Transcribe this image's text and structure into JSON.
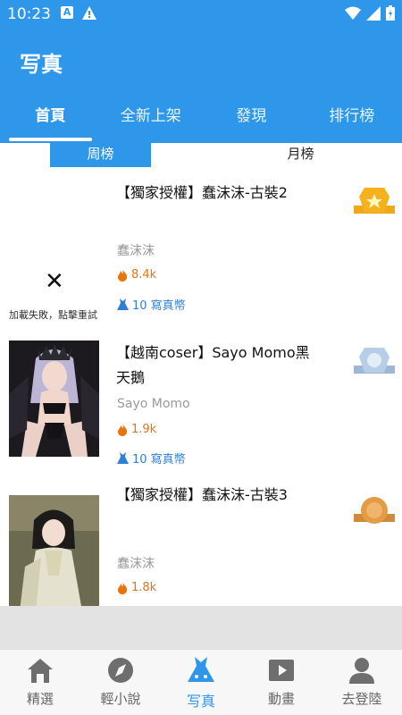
{
  "status": {
    "time": "10:23"
  },
  "appbar": {
    "title": "写真"
  },
  "tabs": [
    {
      "label": "首頁",
      "active": true
    },
    {
      "label": "全新上架",
      "active": false
    },
    {
      "label": "發現",
      "active": false
    },
    {
      "label": "排行榜",
      "active": false
    }
  ],
  "subtabs": [
    {
      "label": "周榜",
      "active": true
    },
    {
      "label": "月榜",
      "active": false
    }
  ],
  "items": [
    {
      "title": "【獨家授權】蠢沫沫-古裝2",
      "author": "蠢沫沫",
      "hot": "8.4k",
      "coins": "10 寫真幣",
      "thumb_error": "加載失敗，點擊重試",
      "rank": 1
    },
    {
      "title": "【越南coser】Sayo Momo黑天鵝",
      "author": "Sayo Momo",
      "hot": "1.9k",
      "coins": "10 寫真幣",
      "rank": 2
    },
    {
      "title": "【獨家授權】蠢沫沫-古裝3",
      "author": "蠢沫沫",
      "hot": "1.8k",
      "rank": 3
    }
  ],
  "bottom_nav": [
    {
      "label": "精選",
      "icon": "home-icon",
      "active": false
    },
    {
      "label": "輕小說",
      "icon": "compass-icon",
      "active": false
    },
    {
      "label": "写真",
      "icon": "dress-icon",
      "active": true
    },
    {
      "label": "動畫",
      "icon": "play-icon",
      "active": false
    },
    {
      "label": "去登陸",
      "icon": "user-icon",
      "active": false
    }
  ],
  "colors": {
    "primary": "#2f97ea",
    "hot": "#e8730f",
    "coin": "#2f7fd6"
  }
}
